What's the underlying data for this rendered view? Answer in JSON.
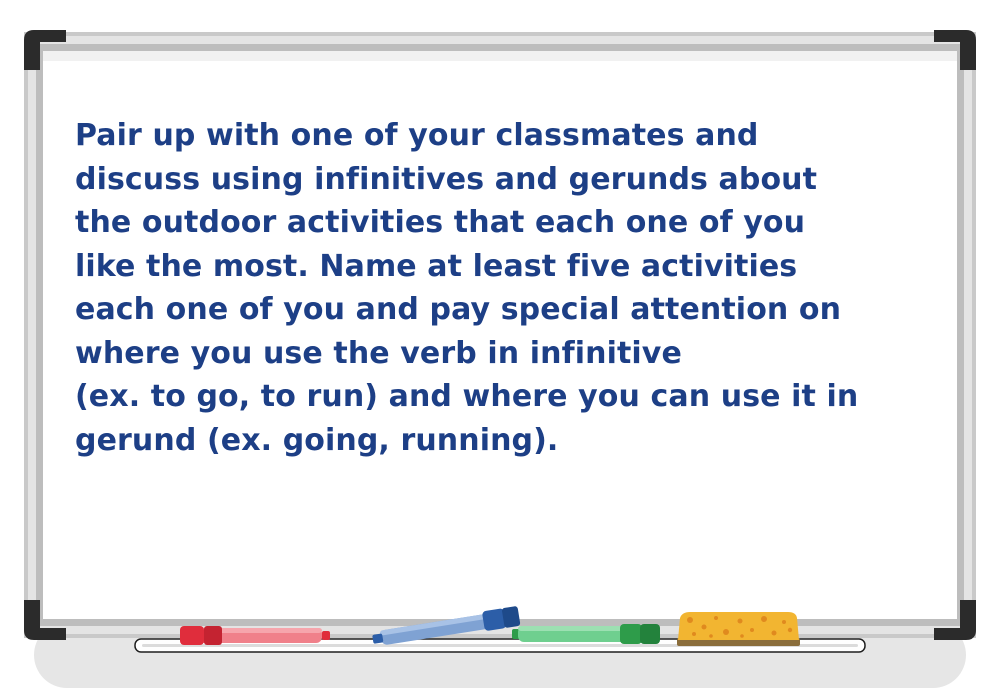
{
  "whiteboard": {
    "instructions_lines": [
      "Pair up with one of your classmates and",
      "discuss using infinitives and gerunds about",
      "the outdoor activities that each one of you",
      "like the most. Name at least five activities",
      "each one of you and pay special attention on",
      "where you use the verb in infinitive",
      "(ex. to go, to run) and where you can use it in",
      "gerund (ex. going, running)."
    ]
  },
  "tray_items": {
    "markers": [
      {
        "name": "red-marker",
        "color": "#e8424b"
      },
      {
        "name": "blue-marker",
        "color": "#2c5ea8"
      },
      {
        "name": "green-marker",
        "color": "#2e9c4a"
      }
    ],
    "eraser": {
      "name": "sponge-eraser",
      "color": "#f2b531"
    }
  },
  "colors": {
    "text": "#1d3f86",
    "frame": "#c4c4c4",
    "corner": "#2b2b2b",
    "board": "#ffffff",
    "shadow": "#e6e6e6"
  }
}
